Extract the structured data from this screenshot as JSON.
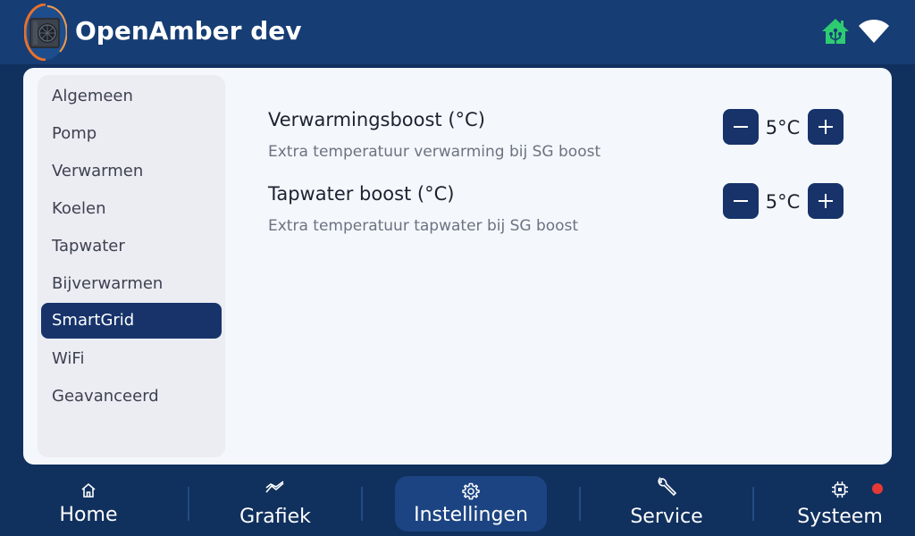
{
  "header": {
    "title": "OpenAmber dev",
    "status_icons": [
      "home-assistant-icon",
      "wifi-icon"
    ],
    "ha_color": "#2ecc71"
  },
  "sidebar": {
    "items": [
      {
        "label": "Algemeen"
      },
      {
        "label": "Pomp"
      },
      {
        "label": "Verwarmen"
      },
      {
        "label": "Koelen"
      },
      {
        "label": "Tapwater"
      },
      {
        "label": "Bijverwarmen"
      },
      {
        "label": "SmartGrid",
        "active": true
      },
      {
        "label": "WiFi"
      },
      {
        "label": "Geavanceerd"
      }
    ]
  },
  "settings": [
    {
      "title": "Verwarmingsboost (°C)",
      "description": "Extra temperatuur verwarming bij SG boost",
      "value": "5°C"
    },
    {
      "title": "Tapwater boost (°C)",
      "description": "Extra temperatuur tapwater bij SG boost",
      "value": "5°C"
    }
  ],
  "nav": {
    "items": [
      {
        "label": "Home",
        "icon": "home-icon"
      },
      {
        "label": "Grafiek",
        "icon": "chart-icon"
      },
      {
        "label": "Instellingen",
        "icon": "gear-icon",
        "active": true
      },
      {
        "label": "Service",
        "icon": "wrench-icon"
      },
      {
        "label": "Systeem",
        "icon": "chip-icon",
        "alert": true
      }
    ]
  },
  "colors": {
    "background": "#10305e",
    "header": "#163d74",
    "accent": "#17336a",
    "alert": "#e53935"
  }
}
